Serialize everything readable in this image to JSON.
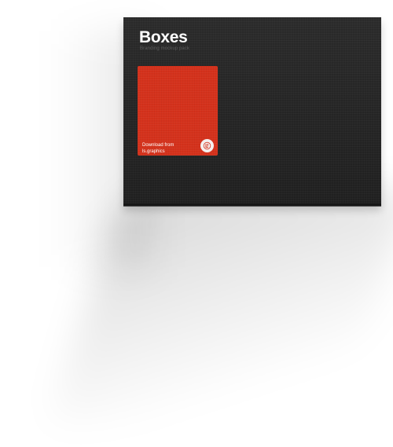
{
  "box": {
    "title": "Boxes",
    "subtitle": "Branding mockup pack",
    "colors": {
      "box": "#232323",
      "label": "#d4321c",
      "badge": "#f4f0ee"
    }
  },
  "label": {
    "line1": "Download from",
    "line2": "ls.graphics",
    "icon": "ls-logo-icon"
  }
}
